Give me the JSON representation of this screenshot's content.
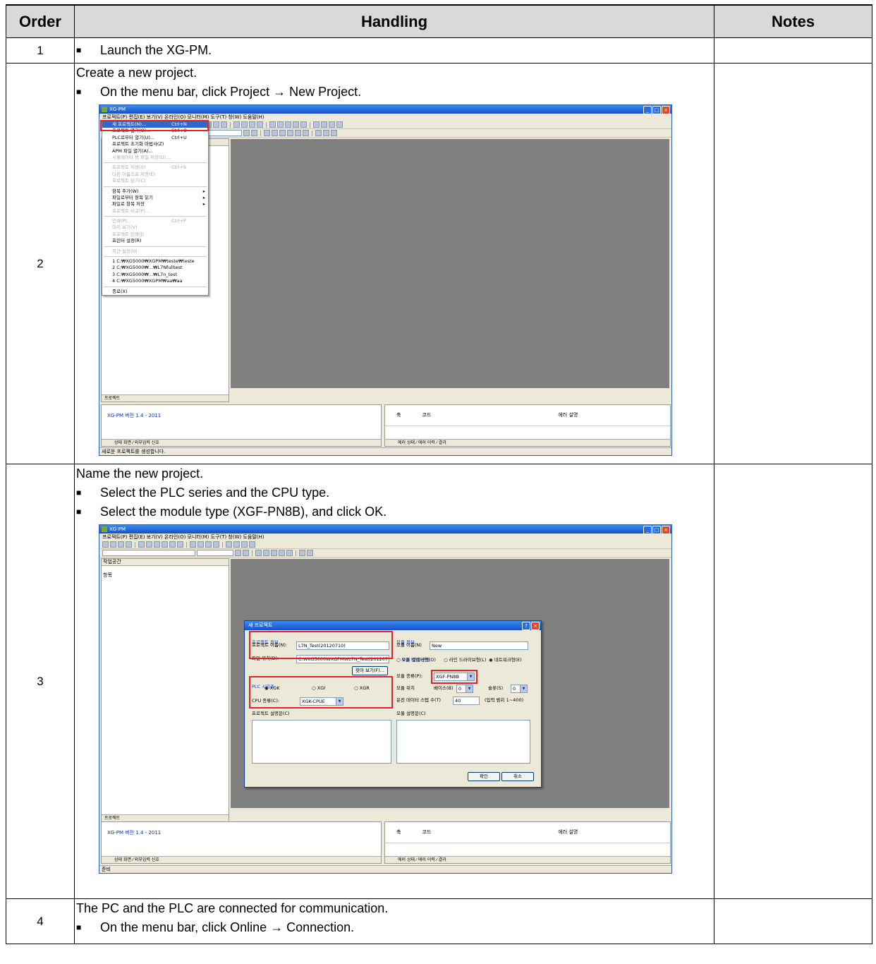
{
  "table": {
    "headers": {
      "order": "Order",
      "handling": "Handling",
      "notes": "Notes"
    },
    "rows": [
      {
        "order": "1",
        "bullets": [
          "Launch the XG-PM."
        ]
      },
      {
        "order": "2",
        "intro": "Create a new project.",
        "bullets": [
          "On the menu bar, click Project → New Project."
        ]
      },
      {
        "order": "3",
        "intro": "Name the new project.",
        "bullets": [
          "Select the PLC series and the CPU type.",
          "Select the module type (XGF-PN8B), and click OK."
        ]
      },
      {
        "order": "4",
        "intro": "The PC and the PLC are connected for communication.",
        "bullets": [
          "On the menu bar, click Online → Connection."
        ]
      }
    ]
  },
  "screen1": {
    "title": "XG-PM",
    "menubar": "프로젝트(P)  편집(E)  보기(V)  온라인(O)  모니터(M)  도구(T)  창(W)  도움말(H)",
    "menu_items": [
      {
        "label": "새 프로젝트(N)...",
        "shortcut": "Ctrl+N"
      },
      {
        "label": "프로젝트 열기(O)...",
        "shortcut": "Ctrl+O"
      },
      {
        "label": "PLC로부터 열기(U)...",
        "shortcut": "Ctrl+U"
      },
      {
        "label": "프로젝트 초기화 마법사(Z)",
        "shortcut": ""
      },
      {
        "label": "APM 파일 열기(A)...",
        "shortcut": ""
      },
      {
        "label": "시뮬레이터 용 파일 저장(D)...",
        "shortcut": ""
      },
      {
        "label": "프로젝트 저장(S)",
        "shortcut": "Ctrl+S"
      },
      {
        "label": "다른 이름으로 저장(E)",
        "shortcut": ""
      },
      {
        "label": "프로젝트 닫기(C)",
        "shortcut": ""
      },
      {
        "label": "항목 추가(W)",
        "shortcut": ""
      },
      {
        "label": "파일로부터 항목 읽기",
        "shortcut": ""
      },
      {
        "label": "파일로 항목 저장",
        "shortcut": ""
      },
      {
        "label": "프로젝트 비교(P)...",
        "shortcut": ""
      },
      {
        "label": "인쇄(P)...",
        "shortcut": "Ctrl+P"
      },
      {
        "label": "미리 보기(V)",
        "shortcut": ""
      },
      {
        "label": "프로젝트 인쇄(J)",
        "shortcut": ""
      },
      {
        "label": "프린터 설정(R)",
        "shortcut": ""
      },
      {
        "label": "최근 설정(U)",
        "shortcut": ""
      },
      {
        "label": "1 C:₩XG5000₩XGPM₩teste₩teste",
        "shortcut": ""
      },
      {
        "label": "2 C:₩XG5000₩...₩L7Nfulltest",
        "shortcut": ""
      },
      {
        "label": "3 C:₩XG5000₩...₩L7n_test",
        "shortcut": ""
      },
      {
        "label": "4 C:₩XG5000₩XGPM₩aa₩aa",
        "shortcut": ""
      },
      {
        "label": "종료(X)",
        "shortcut": ""
      }
    ],
    "workspace_tab": "프로젝트",
    "output_text": "XG-PM 버전 1.4 - 2011",
    "output_tabs": "상태 화면 ⁄ 외부입력 신호",
    "error_headers": {
      "axis": "축",
      "code": "코드",
      "desc": "에러 설명"
    },
    "error_tabs": "에러 상태 ⁄ 에러 이력 ⁄ 결과",
    "status": "새로운 프로젝트를 생성합니다."
  },
  "screen2": {
    "title": "XG-PM",
    "menubar": "프로젝트(P)  편집(E)  보기(V)  온라인(O)  모니터(M)  도구(T)  창(W)  도움말(H)",
    "workspace_title": "작업공간",
    "workspace_item": "항목",
    "workspace_tab": "프로젝트",
    "output_text": "XG-PM 버전 1.4 - 2011",
    "output_tabs": "상태 화면 ⁄ 외부입력 신호",
    "error_headers": {
      "axis": "축",
      "code": "코드",
      "desc": "에러 설명"
    },
    "error_tabs": "에러 상태 ⁄ 에러 이력 ⁄ 결과",
    "status": "준비",
    "dialog": {
      "title": "새 프로젝트",
      "project_info": "프로젝트 정보",
      "project_name_label": "프로젝트 이름(N):",
      "project_name": "L7N_Test(20120710)",
      "file_location_label": "파일 위치(D):",
      "file_location": "C:₩XG5000₩XGPM₩L7N_Test(20120710)",
      "browse": "찾아 보기(F)...",
      "plc_series": "PLC 시리즈",
      "series_options": [
        "XGK",
        "XGI",
        "XGR"
      ],
      "cpu_type_label": "CPU 종류(C):",
      "cpu_type": "XGK-CPUE",
      "project_desc_label": "프로젝트 설명문(C)",
      "module_info": "모듈 정보",
      "module_name_label": "모듈 이름(N)",
      "module_name": "New",
      "module_type_select": "모듈 타입 선택",
      "module_type_options": [
        "오픈 컬렉터형(O)",
        "라인 드라이브형(L)",
        "네트워크형(E)"
      ],
      "module_kind_label": "모듈 종류(P):",
      "module_kind": "XGF-PN8B",
      "module_position_label": "모듈 위치",
      "base_label": "베이스(B)",
      "base": "0",
      "slot_label": "슬롯(S)",
      "slot": "0",
      "axes_label": "운전 데이터 스텝 수(T)",
      "axes": "40",
      "axes_range": "(입력 범위 1~400)",
      "module_desc_label": "모듈 설명문(C)",
      "ok": "확인",
      "cancel": "취소"
    }
  },
  "colors": {
    "header_bg": "#d9d9d9",
    "highlight": "#e8202a",
    "mdi_bg": "#808080",
    "xp_blue": "#1450c8"
  }
}
